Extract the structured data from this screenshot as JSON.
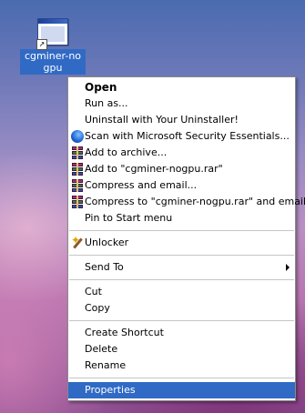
{
  "desktop": {
    "icon_label": "cgminer-nogpu",
    "icon_name": "application-window-icon",
    "shortcut_overlay": "↗"
  },
  "context_menu": {
    "items": [
      {
        "label": "Open",
        "icon": null
      },
      {
        "label": "Run as...",
        "icon": null
      },
      {
        "label": "Uninstall with Your Uninstaller!",
        "icon": null
      },
      {
        "label": "Scan with Microsoft Security Essentials...",
        "icon": "security-essentials-icon"
      },
      {
        "label": "Add to archive...",
        "icon": "winrar-icon"
      },
      {
        "label": "Add to \"cgminer-nogpu.rar\"",
        "icon": "winrar-icon"
      },
      {
        "label": "Compress and email...",
        "icon": "winrar-icon"
      },
      {
        "label": "Compress to \"cgminer-nogpu.rar\" and email",
        "icon": "winrar-icon"
      },
      {
        "label": "Pin to Start menu",
        "icon": null
      },
      {
        "label": "Unlocker",
        "icon": "unlocker-icon"
      },
      {
        "label": "Send To",
        "icon": null,
        "has_submenu": true
      },
      {
        "label": "Cut",
        "icon": null
      },
      {
        "label": "Copy",
        "icon": null
      },
      {
        "label": "Create Shortcut",
        "icon": null
      },
      {
        "label": "Delete",
        "icon": null
      },
      {
        "label": "Rename",
        "icon": null
      },
      {
        "label": "Properties",
        "icon": null,
        "selected": true
      }
    ],
    "selection_color": "#316ac5"
  }
}
